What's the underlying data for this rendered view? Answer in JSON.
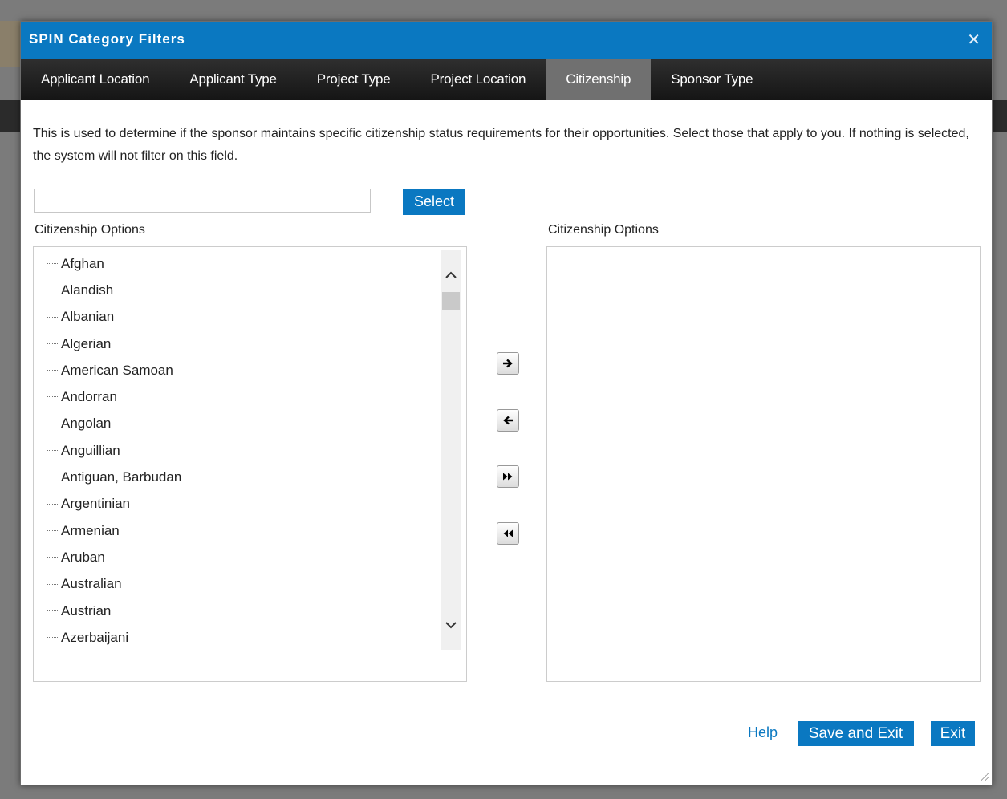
{
  "dialog": {
    "title": "SPIN Category Filters",
    "close_glyph": "✕"
  },
  "tabs": [
    {
      "label": "Applicant Location"
    },
    {
      "label": "Applicant Type"
    },
    {
      "label": "Project Type"
    },
    {
      "label": "Project Location"
    },
    {
      "label": "Citizenship",
      "active": true
    },
    {
      "label": "Sponsor Type"
    }
  ],
  "description": "This is used to determine if the sponsor maintains specific citizenship status requirements for their opportunities. Select those that apply to you. If nothing is selected, the system will not filter on this field.",
  "search": {
    "value": "",
    "placeholder": "",
    "button_label": "Select"
  },
  "left_panel": {
    "label": "Citizenship Options",
    "items": [
      "Afghan",
      "Alandish",
      "Albanian",
      "Algerian",
      "American Samoan",
      "Andorran",
      "Angolan",
      "Anguillian",
      "Antiguan, Barbudan",
      "Argentinian",
      "Armenian",
      "Aruban",
      "Australian",
      "Austrian",
      "Azerbaijani"
    ]
  },
  "right_panel": {
    "label": "Citizenship Options",
    "items": []
  },
  "transfer_buttons": {
    "move_right": "➜",
    "move_left": "⬅",
    "move_all_right": "▸▸",
    "move_all_left": "◂◂"
  },
  "footer": {
    "help": "Help",
    "save_exit": "Save and Exit",
    "exit": "Exit"
  },
  "colors": {
    "accent": "#0a78c1",
    "tabbar": "#1c1c1c",
    "active_tab": "#707070"
  }
}
